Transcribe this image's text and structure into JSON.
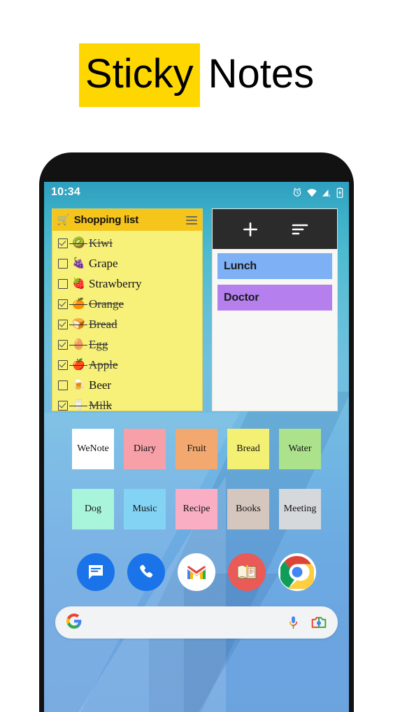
{
  "header": {
    "title_highlight": "Sticky",
    "title_plain": "Notes",
    "highlight_color": "#FFD700"
  },
  "phone": {
    "statusbar": {
      "time": "10:34",
      "icons": [
        "alarm-icon",
        "wifi-icon",
        "signal-no-sim-icon",
        "battery-charging-icon"
      ]
    },
    "shopping_widget": {
      "cart_emoji": "🛒",
      "title": "Shopping list",
      "menu_icon": "hamburger-menu-icon",
      "header_color": "#F5C51C",
      "body_color": "#F7F17A",
      "items": [
        {
          "label": "Kiwi",
          "emoji": "🥝",
          "checked": true
        },
        {
          "label": "Grape",
          "emoji": "🍇",
          "checked": false
        },
        {
          "label": "Strawberry",
          "emoji": "🍓",
          "checked": false
        },
        {
          "label": "Orange",
          "emoji": "🍊",
          "checked": true
        },
        {
          "label": "Bread",
          "emoji": "🍞",
          "checked": true
        },
        {
          "label": "Egg",
          "emoji": "🥚",
          "checked": true
        },
        {
          "label": "Apple",
          "emoji": "🍎",
          "checked": true
        },
        {
          "label": "Beer",
          "emoji": "🍺",
          "checked": false
        },
        {
          "label": "Milk",
          "emoji": "🥛",
          "checked": true
        }
      ]
    },
    "notes_widget": {
      "add_icon": "plus-icon",
      "sort_icon": "sort-icon",
      "header_color": "#2B2B2B",
      "notes": [
        {
          "label": "Lunch",
          "color": "#7EB0F5"
        },
        {
          "label": "Doctor",
          "color": "#B57FEE"
        }
      ]
    },
    "tiles_row_1": [
      {
        "label": "WeNote",
        "color": "#FFFFFF"
      },
      {
        "label": "Diary",
        "color": "#F7A0A8"
      },
      {
        "label": "Fruit",
        "color": "#F2A86E"
      },
      {
        "label": "Bread",
        "color": "#F4F073"
      },
      {
        "label": "Water",
        "color": "#ACE28C"
      }
    ],
    "tiles_row_2": [
      {
        "label": "Dog",
        "color": "#A9F5DC"
      },
      {
        "label": "Music",
        "color": "#83D3F5"
      },
      {
        "label": "Recipe",
        "color": "#F9AEC3"
      },
      {
        "label": "Books",
        "color": "#D5C7BD"
      },
      {
        "label": "Meeting",
        "color": "#D6D9DC"
      }
    ],
    "dock": [
      {
        "name": "messages-app-icon",
        "color": "#1A73E8"
      },
      {
        "name": "phone-app-icon",
        "color": "#1A73E8"
      },
      {
        "name": "gmail-app-icon",
        "color": "#FFFFFF"
      },
      {
        "name": "dictionary-app-icon",
        "color": "#EA5A56"
      },
      {
        "name": "chrome-app-icon",
        "color": "#FFFFFF"
      }
    ],
    "search": {
      "value": "",
      "placeholder": "",
      "google_icon": "google-g-icon",
      "mic_icon": "microphone-icon",
      "lens_icon": "google-lens-camera-icon"
    }
  }
}
